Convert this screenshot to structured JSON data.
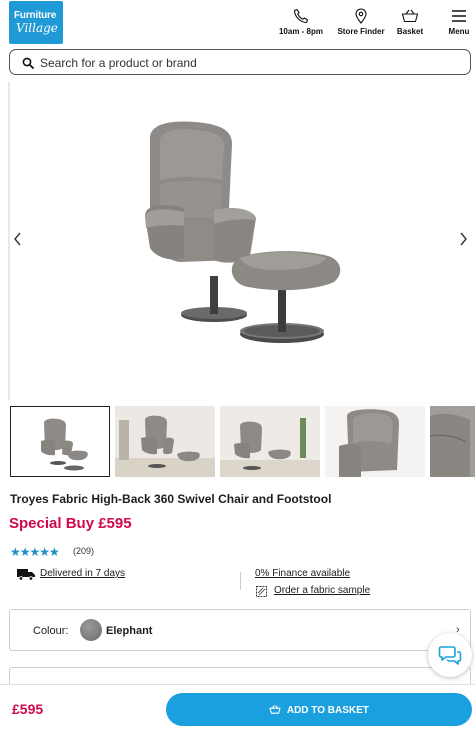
{
  "brand": {
    "logo_line1": "Furniture",
    "logo_line2": "Village"
  },
  "header": {
    "items": [
      {
        "icon": "phone-icon",
        "label": "10am - 8pm"
      },
      {
        "icon": "location-pin-icon",
        "label": "Store Finder"
      },
      {
        "icon": "basket-icon",
        "label": "Basket"
      },
      {
        "icon": "menu-icon",
        "label": "Menu"
      }
    ]
  },
  "search": {
    "placeholder": "Search for a product or brand",
    "value": ""
  },
  "gallery": {
    "image_count": 5,
    "active_index": 0,
    "image_alt": "Troyes Fabric High-Back 360 Swivel Chair and Footstool"
  },
  "product": {
    "title": "Troyes Fabric High-Back 360 Swivel Chair and Footstool",
    "price_label": "Special Buy £595",
    "rating_value": 4.5,
    "rating_max": 5,
    "stars": "★★★★★",
    "review_count": "(209)",
    "delivery": "Delivered in 7 days",
    "finance": "0% Finance available",
    "fabric_sample": "Order a fabric sample"
  },
  "colour": {
    "label": "Colour:",
    "value": "Elephant",
    "swatch_color": "#7f7e7c"
  },
  "footer": {
    "price": "£595",
    "add_to_basket": "ADD TO BASKET"
  },
  "colors": {
    "accent_blue": "#1ba0df",
    "sale_pink": "#d0094f",
    "star_blue": "#1e8fc8"
  }
}
